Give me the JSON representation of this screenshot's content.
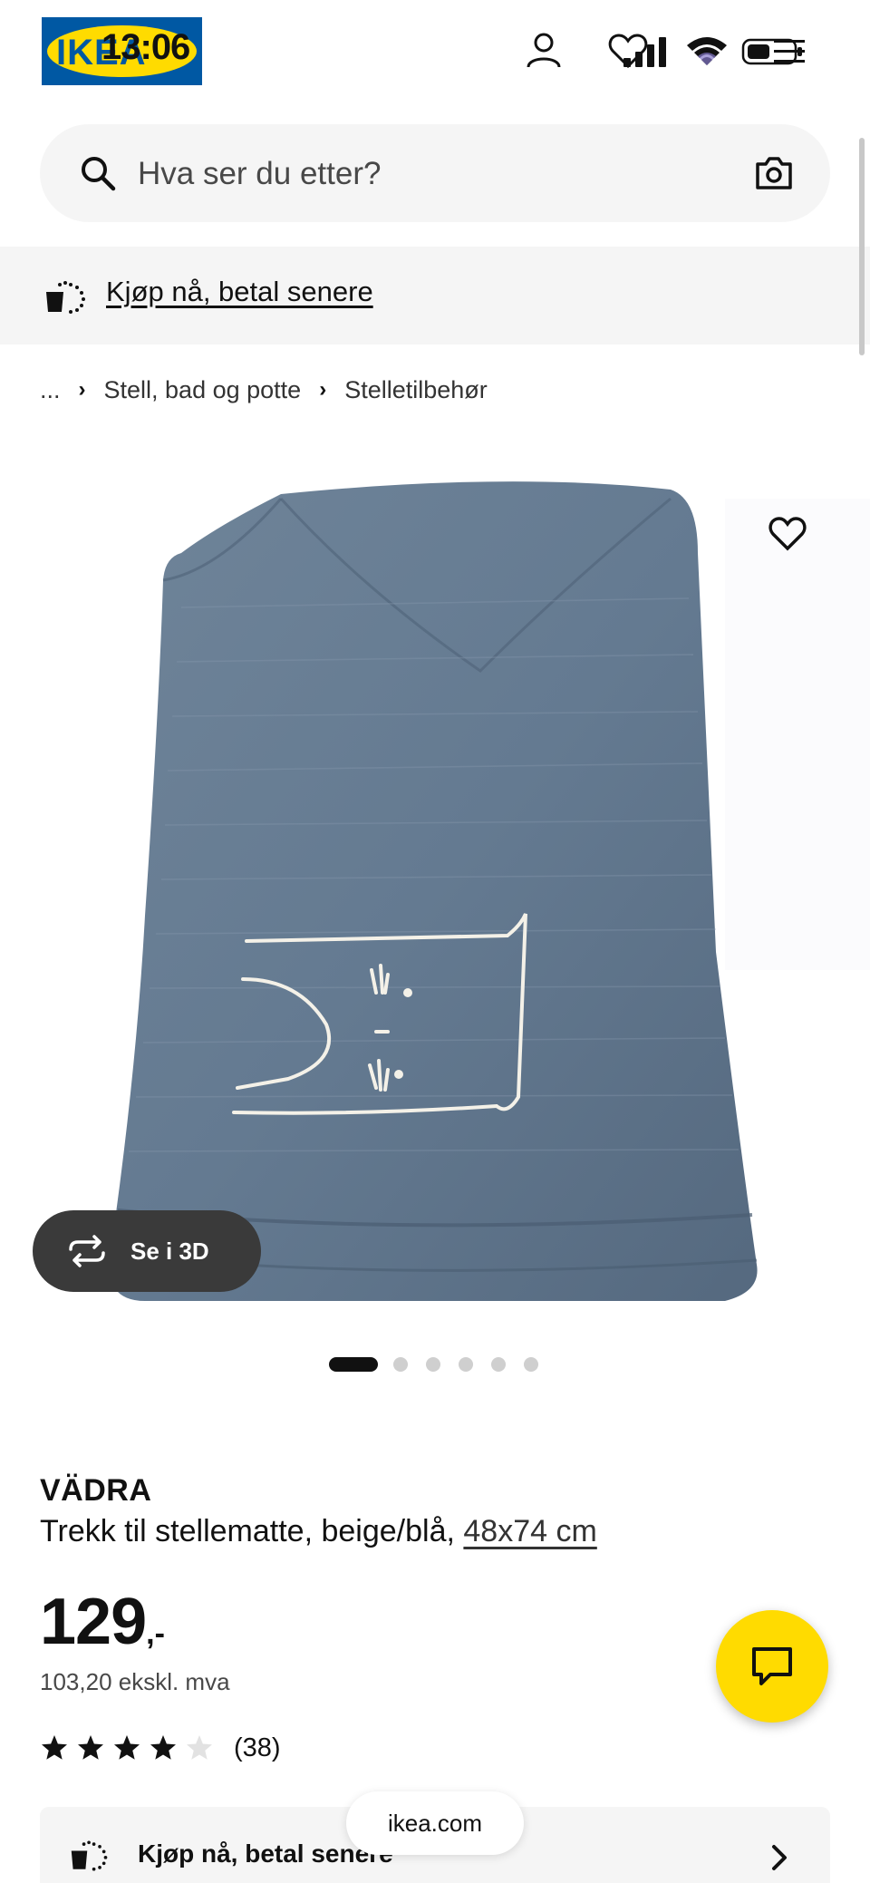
{
  "status_bar": {
    "time": "13:06"
  },
  "logo": {
    "text": "IKEA"
  },
  "search": {
    "placeholder": "Hva ser du etter?"
  },
  "banner": {
    "text": "Kjøp nå, betal senere"
  },
  "breadcrumb": {
    "ellipsis": "...",
    "items": [
      "Stell, bad og potte",
      "Stelletilbehør"
    ]
  },
  "product": {
    "name": "VÄDRA",
    "description": "Trekk til stellematte, beige/blå, ",
    "size": "48x74 cm",
    "price_integer": "129",
    "price_suffix": ",-",
    "price_ex_vat": "103,20 ekskl. mva",
    "rating_value": 4,
    "rating_max": 5,
    "review_count": "(38)"
  },
  "view_3d": {
    "label": "Se i 3D"
  },
  "carousel": {
    "count": 6,
    "active_index": 0
  },
  "bottom_card": {
    "text": "Kjøp nå, betal senere"
  },
  "url_pill": {
    "text": "ikea.com"
  },
  "colors": {
    "brand_blue": "#0058a3",
    "brand_yellow": "#ffdb00",
    "textile_blue": "#647a91"
  },
  "icons": [
    "search-icon",
    "camera-icon",
    "person-icon",
    "heart-icon",
    "signal-icon",
    "wifi-icon",
    "battery-icon",
    "menu-icon",
    "rotate-3d-icon",
    "chat-icon",
    "star-icon",
    "chevron-right-icon",
    "payment-icon"
  ]
}
